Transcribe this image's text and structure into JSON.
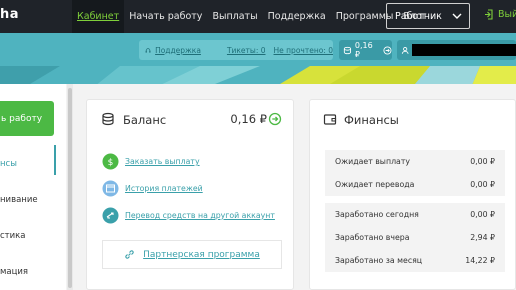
{
  "header": {
    "logo": "ha",
    "nav": [
      "Кабинет",
      "Начать работу",
      "Выплаты",
      "Поддержка",
      "Программы",
      "Блог"
    ],
    "role_select": "Работник",
    "logout": "Вый"
  },
  "subbar": {
    "support": "Поддержка",
    "tickets": "Тикеты: 0",
    "unread": "Не прочтено: 0",
    "balance": "0,16 ₽"
  },
  "sidebar": {
    "withdraw_button": "ь работу",
    "items": [
      "нсы",
      "нивание",
      "стика",
      "мация"
    ]
  },
  "balance_card": {
    "title": "Баланс",
    "value": "0,16 ₽",
    "actions": [
      "Заказать выплату",
      "История платежей",
      "Перевод средств на другой аккаунт"
    ],
    "partner": "Партнерская программа"
  },
  "finance_card": {
    "title": "Финансы",
    "group1": [
      {
        "label": "Ожидает выплату",
        "value": "0,00 ₽"
      },
      {
        "label": "Ожидает перевода",
        "value": "0,00 ₽"
      }
    ],
    "group2": [
      {
        "label": "Заработано сегодня",
        "value": "0,00 ₽"
      },
      {
        "label": "Заработано вчера",
        "value": "2,94 ₽"
      },
      {
        "label": "Заработано за месяц",
        "value": "14,22 ₽"
      }
    ]
  },
  "colors": {
    "accent_green": "#4cb944",
    "teal": "#3aa0aa",
    "nav_bg": "#1f2329",
    "subbar_bg": "#4fb3bf"
  }
}
